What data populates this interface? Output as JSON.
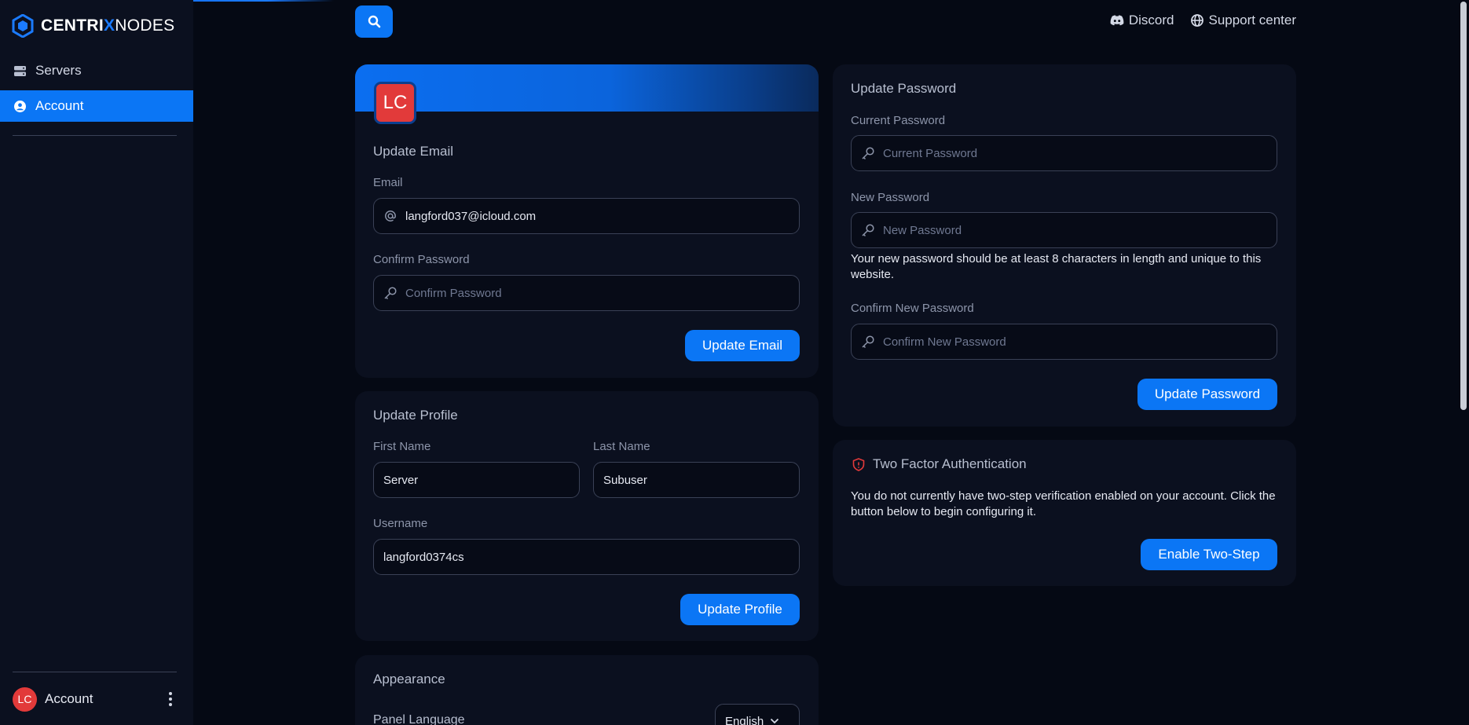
{
  "brand": {
    "part1": "CENTRI",
    "part2": "X",
    "part3": "NODES"
  },
  "sidebar": {
    "items": [
      {
        "label": "Servers",
        "icon": "server-icon"
      },
      {
        "label": "Account",
        "icon": "user-circle-icon",
        "active": true
      }
    ],
    "footer": {
      "avatar_initials": "LC",
      "label": "Account"
    }
  },
  "topbar": {
    "links": [
      {
        "label": "Discord",
        "icon": "discord-icon"
      },
      {
        "label": "Support center",
        "icon": "globe-icon"
      }
    ]
  },
  "email_card": {
    "avatar_initials": "LC",
    "title": "Update Email",
    "email_label": "Email",
    "email_value": "langford037@icloud.com",
    "password_label": "Confirm Password",
    "password_placeholder": "Confirm Password",
    "button": "Update Email"
  },
  "profile_card": {
    "title": "Update Profile",
    "first_name_label": "First Name",
    "first_name_value": "Server",
    "last_name_label": "Last Name",
    "last_name_value": "Subuser",
    "username_label": "Username",
    "username_value": "langford0374cs",
    "button": "Update Profile"
  },
  "appearance_card": {
    "title": "Appearance",
    "language_label": "Panel Language",
    "language_value": "English"
  },
  "password_card": {
    "title": "Update Password",
    "current_label": "Current Password",
    "current_placeholder": "Current Password",
    "new_label": "New Password",
    "new_placeholder": "New Password",
    "help": "Your new password should be at least 8 characters in length and unique to this website.",
    "confirm_label": "Confirm New Password",
    "confirm_placeholder": "Confirm New Password",
    "button": "Update Password"
  },
  "twofa_card": {
    "title": "Two Factor Authentication",
    "text": "You do not currently have two-step verification enabled on your account. Click the button below to begin configuring it.",
    "button": "Enable Two-Step"
  },
  "colors": {
    "accent": "#0b76f5",
    "avatar": "#e23a3a",
    "background": "#050914",
    "card": "#0b101f"
  }
}
